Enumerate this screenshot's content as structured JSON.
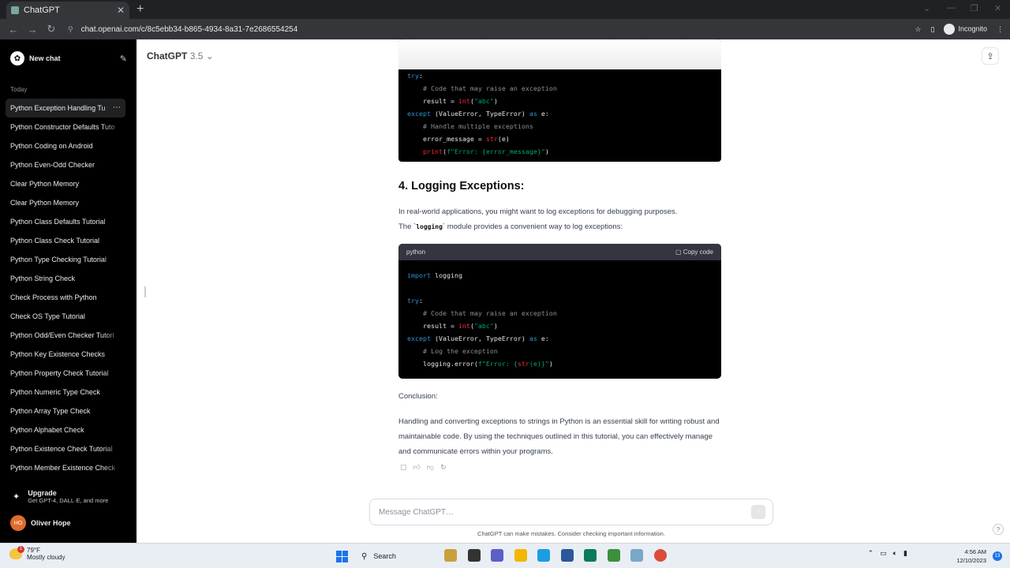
{
  "browser": {
    "tab_title": "ChatGPT",
    "url": "chat.openai.com/c/8c5ebb34-b865-4934-8a31-7e2686554254",
    "incognito_label": "Incognito"
  },
  "sidebar": {
    "new_chat_label": "New chat",
    "section_label": "Today",
    "items": [
      {
        "label": "Python Exception Handling Tu"
      },
      {
        "label": "Python Constructor Defaults Tuto"
      },
      {
        "label": "Python Coding on Android"
      },
      {
        "label": "Python Even-Odd Checker"
      },
      {
        "label": "Clear Python Memory"
      },
      {
        "label": "Clear Python Memory"
      },
      {
        "label": "Python Class Defaults Tutorial"
      },
      {
        "label": "Python Class Check Tutorial"
      },
      {
        "label": "Python Type Checking Tutorial"
      },
      {
        "label": "Python String Check"
      },
      {
        "label": "Check Process with Python"
      },
      {
        "label": "Check OS Type Tutorial"
      },
      {
        "label": "Python Odd/Even Checker Tutori"
      },
      {
        "label": "Python Key Existence Checks"
      },
      {
        "label": "Python Property Check Tutorial"
      },
      {
        "label": "Python Numeric Type Check"
      },
      {
        "label": "Python Array Type Check"
      },
      {
        "label": "Python Alphabet Check"
      },
      {
        "label": "Python Existence Check Tutorial"
      },
      {
        "label": "Python Member Existence Check"
      }
    ],
    "upgrade_title": "Upgrade",
    "upgrade_subtitle": "Get GPT-4, DALL·E, and more",
    "user_initials": "HO",
    "user_name": "Oliver Hope"
  },
  "header": {
    "model_name": "ChatGPT",
    "model_version": "3.5"
  },
  "message": {
    "heading": "4. Logging Exceptions:",
    "para1_part1": "In real-world applications, you might want to log exceptions for debugging purposes.",
    "para1_part2_a": "The `",
    "para1_code": "logging",
    "para1_part2_b": "` module provides a convenient way to log exceptions:",
    "code_lang": "python",
    "copy_label": "Copy code",
    "conclusion_label": "Conclusion:",
    "conclusion_text": "Handling and converting exceptions to strings in Python is an essential skill for writing robust and maintainable code. By using the techniques outlined in this tutorial, you can effectively manage and communicate errors within your programs."
  },
  "composer": {
    "placeholder": "Message ChatGPT…",
    "disclaimer": "ChatGPT can make mistakes. Consider checking important information."
  },
  "taskbar": {
    "weather_temp": "79°F",
    "weather_desc": "Mostly cloudy",
    "weather_badge": "1",
    "search_label": "Search",
    "time": "4:56 AM",
    "date": "12/10/2023",
    "notif_count": "13"
  }
}
